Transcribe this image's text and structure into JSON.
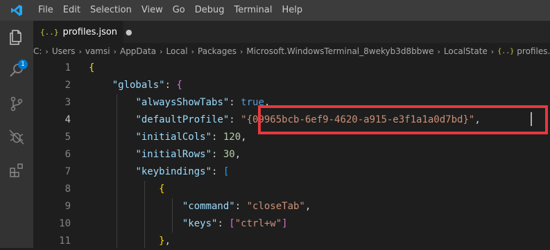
{
  "menu": [
    "File",
    "Edit",
    "Selection",
    "View",
    "Go",
    "Debug",
    "Terminal",
    "Help"
  ],
  "activity": {
    "icons": [
      "explorer-icon",
      "search-icon",
      "source-control-icon",
      "debug-icon",
      "extensions-icon"
    ],
    "badge": "1"
  },
  "tab": {
    "icon": "{..}",
    "label": "profiles.json",
    "dirty_marker": "●"
  },
  "breadcrumb": {
    "parts": [
      "C:",
      "Users",
      "vamsi",
      "AppData",
      "Local",
      "Packages",
      "Microsoft.WindowsTerminal_8wekyb3d8bbwe",
      "LocalState"
    ],
    "file_icon": "{..}",
    "file": "profiles.json"
  },
  "editor": {
    "line_numbers": [
      "1",
      "2",
      "3",
      "4",
      "5",
      "6",
      "7",
      "8",
      "9",
      "10",
      "11"
    ],
    "active_line": "4",
    "tokens": {
      "globals_key": "\"globals\"",
      "alwaysShowTabs_key": "\"alwaysShowTabs\"",
      "alwaysShowTabs_val": "true",
      "defaultProfile_key": "\"defaultProfile\"",
      "defaultProfile_val": "\"{09965bcb-6ef9-4620-a915-e3f1a1a0d7bd}\"",
      "initialCols_key": "\"initialCols\"",
      "initialCols_val": "120",
      "initialRows_key": "\"initialRows\"",
      "initialRows_val": "30",
      "keybindings_key": "\"keybindings\"",
      "command_key": "\"command\"",
      "command_val": "\"closeTab\"",
      "keys_key": "\"keys\"",
      "keys_val": "\"ctrl+w\""
    }
  },
  "colors": {
    "highlight_border": "#e8383d",
    "accent": "#007acc"
  }
}
